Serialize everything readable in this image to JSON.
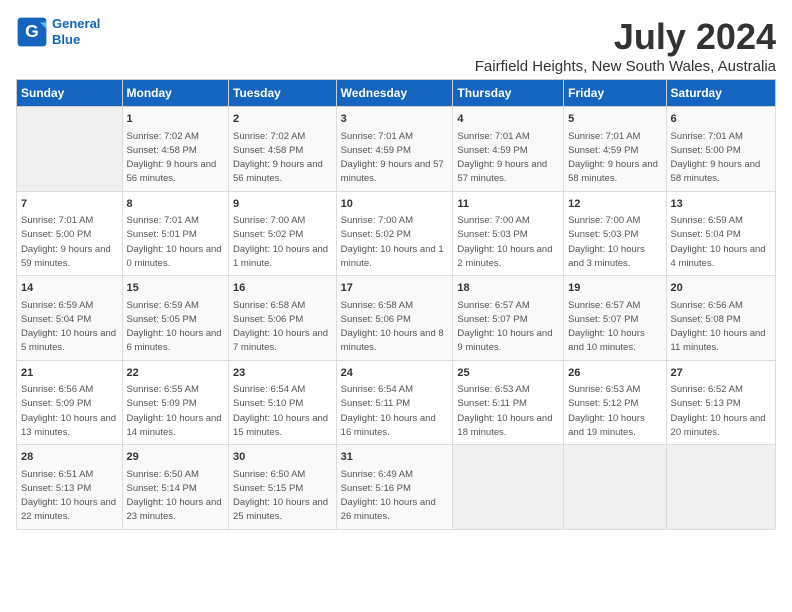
{
  "app": {
    "name_line1": "General",
    "name_line2": "Blue"
  },
  "calendar": {
    "title": "July 2024",
    "subtitle": "Fairfield Heights, New South Wales, Australia",
    "headers": [
      "Sunday",
      "Monday",
      "Tuesday",
      "Wednesday",
      "Thursday",
      "Friday",
      "Saturday"
    ],
    "weeks": [
      [
        {
          "day": "",
          "content": ""
        },
        {
          "day": "1",
          "content": "Sunrise: 7:02 AM\nSunset: 4:58 PM\nDaylight: 9 hours and 56 minutes."
        },
        {
          "day": "2",
          "content": "Sunrise: 7:02 AM\nSunset: 4:58 PM\nDaylight: 9 hours and 56 minutes."
        },
        {
          "day": "3",
          "content": "Sunrise: 7:01 AM\nSunset: 4:59 PM\nDaylight: 9 hours and 57 minutes."
        },
        {
          "day": "4",
          "content": "Sunrise: 7:01 AM\nSunset: 4:59 PM\nDaylight: 9 hours and 57 minutes."
        },
        {
          "day": "5",
          "content": "Sunrise: 7:01 AM\nSunset: 4:59 PM\nDaylight: 9 hours and 58 minutes."
        },
        {
          "day": "6",
          "content": "Sunrise: 7:01 AM\nSunset: 5:00 PM\nDaylight: 9 hours and 58 minutes."
        }
      ],
      [
        {
          "day": "7",
          "content": "Sunrise: 7:01 AM\nSunset: 5:00 PM\nDaylight: 9 hours and 59 minutes."
        },
        {
          "day": "8",
          "content": "Sunrise: 7:01 AM\nSunset: 5:01 PM\nDaylight: 10 hours and 0 minutes."
        },
        {
          "day": "9",
          "content": "Sunrise: 7:00 AM\nSunset: 5:02 PM\nDaylight: 10 hours and 1 minute."
        },
        {
          "day": "10",
          "content": "Sunrise: 7:00 AM\nSunset: 5:02 PM\nDaylight: 10 hours and 1 minute."
        },
        {
          "day": "11",
          "content": "Sunrise: 7:00 AM\nSunset: 5:03 PM\nDaylight: 10 hours and 2 minutes."
        },
        {
          "day": "12",
          "content": "Sunrise: 7:00 AM\nSunset: 5:03 PM\nDaylight: 10 hours and 3 minutes."
        },
        {
          "day": "13",
          "content": "Sunrise: 6:59 AM\nSunset: 5:04 PM\nDaylight: 10 hours and 4 minutes."
        }
      ],
      [
        {
          "day": "14",
          "content": "Sunrise: 6:59 AM\nSunset: 5:04 PM\nDaylight: 10 hours and 5 minutes."
        },
        {
          "day": "15",
          "content": "Sunrise: 6:59 AM\nSunset: 5:05 PM\nDaylight: 10 hours and 6 minutes."
        },
        {
          "day": "16",
          "content": "Sunrise: 6:58 AM\nSunset: 5:06 PM\nDaylight: 10 hours and 7 minutes."
        },
        {
          "day": "17",
          "content": "Sunrise: 6:58 AM\nSunset: 5:06 PM\nDaylight: 10 hours and 8 minutes."
        },
        {
          "day": "18",
          "content": "Sunrise: 6:57 AM\nSunset: 5:07 PM\nDaylight: 10 hours and 9 minutes."
        },
        {
          "day": "19",
          "content": "Sunrise: 6:57 AM\nSunset: 5:07 PM\nDaylight: 10 hours and 10 minutes."
        },
        {
          "day": "20",
          "content": "Sunrise: 6:56 AM\nSunset: 5:08 PM\nDaylight: 10 hours and 11 minutes."
        }
      ],
      [
        {
          "day": "21",
          "content": "Sunrise: 6:56 AM\nSunset: 5:09 PM\nDaylight: 10 hours and 13 minutes."
        },
        {
          "day": "22",
          "content": "Sunrise: 6:55 AM\nSunset: 5:09 PM\nDaylight: 10 hours and 14 minutes."
        },
        {
          "day": "23",
          "content": "Sunrise: 6:54 AM\nSunset: 5:10 PM\nDaylight: 10 hours and 15 minutes."
        },
        {
          "day": "24",
          "content": "Sunrise: 6:54 AM\nSunset: 5:11 PM\nDaylight: 10 hours and 16 minutes."
        },
        {
          "day": "25",
          "content": "Sunrise: 6:53 AM\nSunset: 5:11 PM\nDaylight: 10 hours and 18 minutes."
        },
        {
          "day": "26",
          "content": "Sunrise: 6:53 AM\nSunset: 5:12 PM\nDaylight: 10 hours and 19 minutes."
        },
        {
          "day": "27",
          "content": "Sunrise: 6:52 AM\nSunset: 5:13 PM\nDaylight: 10 hours and 20 minutes."
        }
      ],
      [
        {
          "day": "28",
          "content": "Sunrise: 6:51 AM\nSunset: 5:13 PM\nDaylight: 10 hours and 22 minutes."
        },
        {
          "day": "29",
          "content": "Sunrise: 6:50 AM\nSunset: 5:14 PM\nDaylight: 10 hours and 23 minutes."
        },
        {
          "day": "30",
          "content": "Sunrise: 6:50 AM\nSunset: 5:15 PM\nDaylight: 10 hours and 25 minutes."
        },
        {
          "day": "31",
          "content": "Sunrise: 6:49 AM\nSunset: 5:16 PM\nDaylight: 10 hours and 26 minutes."
        },
        {
          "day": "",
          "content": ""
        },
        {
          "day": "",
          "content": ""
        },
        {
          "day": "",
          "content": ""
        }
      ]
    ]
  }
}
